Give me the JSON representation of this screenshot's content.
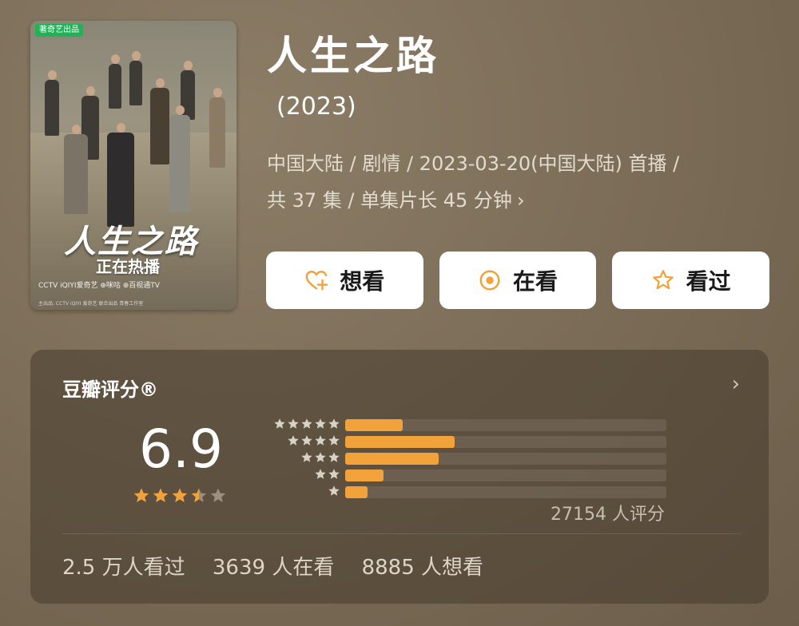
{
  "poster": {
    "badge": "著奇艺出品",
    "title": "人生之路",
    "subtitle": "正在热播",
    "logos": "CCTV  iQIYI爱奇艺  ⊕咪咕  ⊕百视通TV",
    "footer": "主出品:  CCTV  iQIYI 爱奇艺     联合出品       青春工作室"
  },
  "header": {
    "title": "人生之路",
    "year": "(2023)",
    "meta_line1": "中国大陆 / 剧情 / 2023-03-20(中国大陆) 首播 /",
    "meta_line2": "共 37 集 / 单集片长 45 分钟",
    "meta_chevron": "›"
  },
  "actions": {
    "want_label": "想看",
    "watching_label": "在看",
    "watched_label": "看过"
  },
  "rating": {
    "panel_title": "豆瓣评分®",
    "chevron": "›",
    "score": "6.9",
    "star_level": 3.5,
    "votes": "27154 人评分",
    "distribution": [
      {
        "stars": 5,
        "fraction": 0.18
      },
      {
        "stars": 4,
        "fraction": 0.34
      },
      {
        "stars": 3,
        "fraction": 0.29
      },
      {
        "stars": 2,
        "fraction": 0.12
      },
      {
        "stars": 1,
        "fraction": 0.07
      }
    ]
  },
  "stats": {
    "watched": "2.5 万人看过",
    "watching": "3639 人在看",
    "want": "8885 人想看"
  },
  "colors": {
    "accent": "#f2a23b",
    "star_empty": "#9a9082",
    "badge_green": "#1fb356"
  }
}
